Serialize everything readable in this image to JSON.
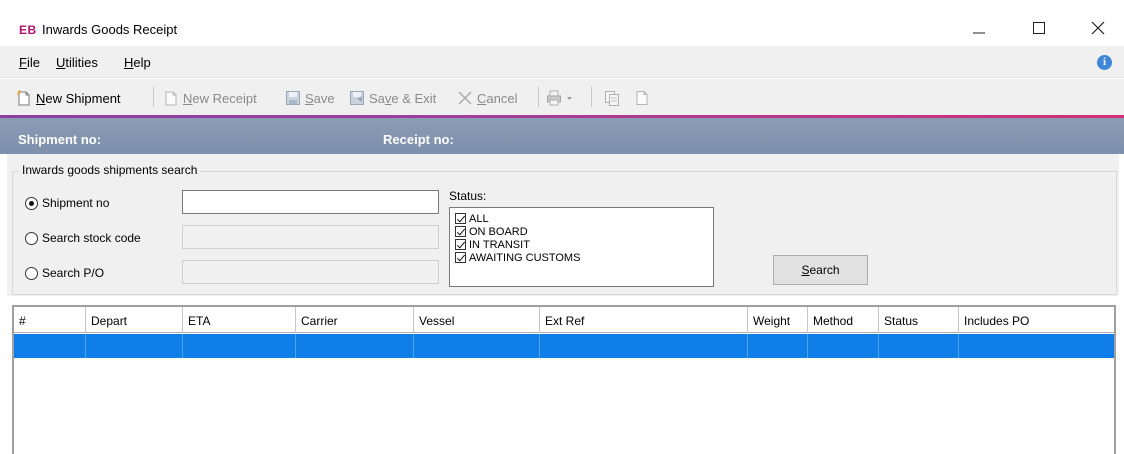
{
  "window": {
    "logo": "EB",
    "title": "Inwards Goods Receipt",
    "controls": [
      "minimize-icon",
      "maximize-icon",
      "close-icon"
    ]
  },
  "menu": {
    "items": [
      {
        "label": "File",
        "mnemonic": "F",
        "rest": "ile"
      },
      {
        "label": "Utilities",
        "mnemonic": "U",
        "rest": "tilities"
      },
      {
        "label": "Help",
        "mnemonic": "H",
        "rest": "elp"
      }
    ],
    "info_icon": "i"
  },
  "toolbar": {
    "new_shipment": {
      "pre": "",
      "mn": "N",
      "post": "ew Shipment"
    },
    "new_receipt": {
      "pre": "",
      "mn": "N",
      "post": "ew Receipt"
    },
    "save": {
      "pre": "",
      "mn": "S",
      "post": "ave"
    },
    "save_exit": {
      "pre": "Sa",
      "mn": "v",
      "post": "e & Exit"
    },
    "cancel": {
      "pre": "",
      "mn": "C",
      "post": "ancel"
    }
  },
  "header": {
    "shipment_no_label": "Shipment no:",
    "receipt_no_label": "Receipt no:"
  },
  "search": {
    "group_title": "Inwards goods shipments search",
    "options": [
      {
        "label": "Shipment no",
        "checked": true
      },
      {
        "label": "Search stock code",
        "checked": false
      },
      {
        "label": "Search P/O",
        "checked": false
      }
    ],
    "shipment_no_value": "",
    "stock_code_value": "",
    "po_value": "",
    "status_label": "Status:",
    "statuses": [
      {
        "label": "ALL",
        "checked": true
      },
      {
        "label": "ON BOARD",
        "checked": true
      },
      {
        "label": "IN TRANSIT",
        "checked": true
      },
      {
        "label": "AWAITING CUSTOMS",
        "checked": true
      }
    ],
    "search_button": {
      "pre": "",
      "mn": "S",
      "post": "earch"
    }
  },
  "grid": {
    "columns": [
      "#",
      "Depart",
      "ETA",
      "Carrier",
      "Vessel",
      "Ext Ref",
      "Weight",
      "Method",
      "Status",
      "Includes PO"
    ],
    "rows": [
      [
        "",
        "",
        "",
        "",
        "",
        "",
        "",
        "",
        "",
        ""
      ]
    ]
  },
  "colors": {
    "accent_start": "#8c3fa3",
    "accent_end": "#d43075",
    "header_band": "#8a9cb5",
    "selection": "#0f7ee8",
    "logo": "#b3126f"
  }
}
